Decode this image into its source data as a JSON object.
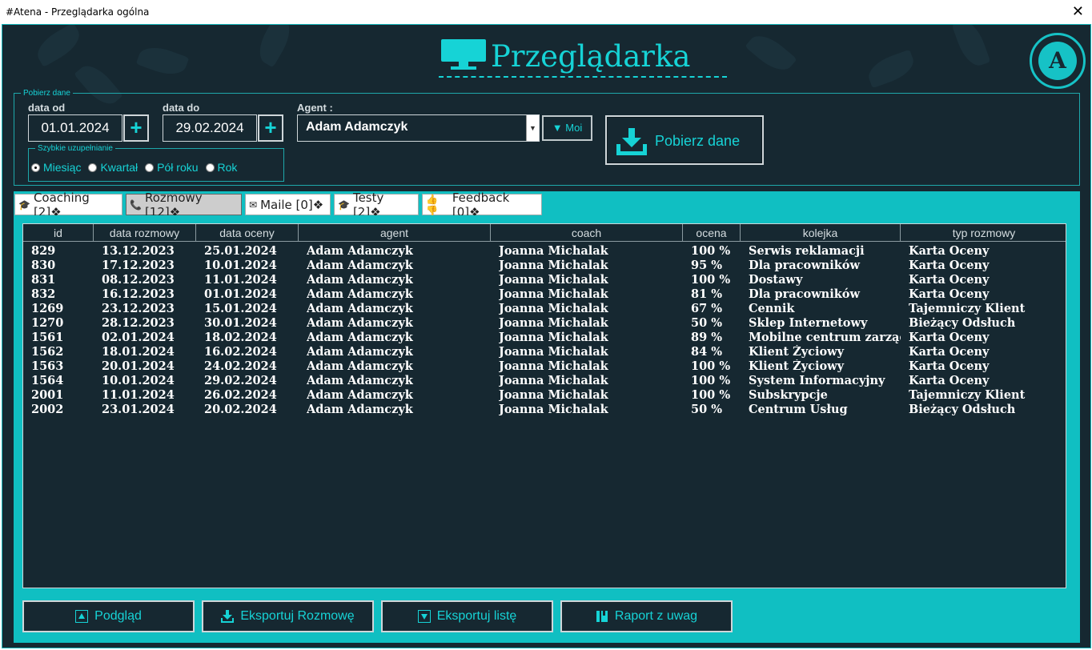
{
  "window": {
    "title": "#Atena - Przeglądarka ogólna",
    "close": "✕"
  },
  "header": {
    "title": "Przeglądarka",
    "logo_letter": "A"
  },
  "pobierz": {
    "legend": "Pobierz dane",
    "date_from_label": "data od",
    "date_from": "01.01.2024",
    "date_to_label": "data do",
    "date_to": "29.02.2024",
    "plus": "+",
    "agent_label": "Agent :",
    "agent_value": "Adam Adamczyk",
    "moi_label": "▼ Moi",
    "button_label": "Pobierz dane",
    "quick": {
      "legend": "Szybkie uzupełnianie",
      "options": [
        "Miesiąc",
        "Kwartał",
        "Pół roku",
        "Rok"
      ],
      "selected": "Miesiąc"
    }
  },
  "tabs": [
    {
      "label": "Coaching [2]❖",
      "icon": "graduation-cap-icon"
    },
    {
      "label": "Rozmowy [12]❖",
      "icon": "phone-icon",
      "active": true
    },
    {
      "label": "Maile [0]❖",
      "icon": "mail-icon"
    },
    {
      "label": "Testy [2]❖",
      "icon": "graduation-cap-icon"
    },
    {
      "label": "Feedback [0]❖",
      "icon": "thumbs-icon"
    }
  ],
  "table": {
    "columns": [
      "id",
      "data rozmowy",
      "data oceny",
      "agent",
      "coach",
      "ocena",
      "kolejka",
      "typ rozmowy"
    ],
    "rows": [
      [
        "829",
        "13.12.2023",
        "25.01.2024",
        "Adam Adamczyk",
        "Joanna Michalak",
        "100 %",
        "Serwis reklamacji",
        "Karta Oceny"
      ],
      [
        "830",
        "17.12.2023",
        "10.01.2024",
        "Adam Adamczyk",
        "Joanna Michalak",
        "95 %",
        "Dla pracowników",
        "Karta Oceny"
      ],
      [
        "831",
        "08.12.2023",
        "11.01.2024",
        "Adam Adamczyk",
        "Joanna Michalak",
        "100 %",
        "Dostawy",
        "Karta Oceny"
      ],
      [
        "832",
        "16.12.2023",
        "01.01.2024",
        "Adam Adamczyk",
        "Joanna Michalak",
        "81 %",
        "Dla pracowników",
        "Karta Oceny"
      ],
      [
        "1269",
        "23.12.2023",
        "15.01.2024",
        "Adam Adamczyk",
        "Joanna Michalak",
        "67 %",
        "Cennik",
        "Tajemniczy Klient"
      ],
      [
        "1270",
        "28.12.2023",
        "30.01.2024",
        "Adam Adamczyk",
        "Joanna Michalak",
        "50 %",
        "Sklep Internetowy",
        "Bieżący Odsłuch"
      ],
      [
        "1561",
        "02.01.2024",
        "18.02.2024",
        "Adam Adamczyk",
        "Joanna Michalak",
        "89 %",
        "Mobilne centrum zarządzania",
        "Karta Oceny"
      ],
      [
        "1562",
        "18.01.2024",
        "16.02.2024",
        "Adam Adamczyk",
        "Joanna Michalak",
        "84 %",
        "Klient Życiowy",
        "Karta Oceny"
      ],
      [
        "1563",
        "20.01.2024",
        "24.02.2024",
        "Adam Adamczyk",
        "Joanna Michalak",
        "100 %",
        "Klient Życiowy",
        "Karta Oceny"
      ],
      [
        "1564",
        "10.01.2024",
        "29.02.2024",
        "Adam Adamczyk",
        "Joanna Michalak",
        "100 %",
        "System Informacyjny",
        "Karta Oceny"
      ],
      [
        "2001",
        "11.01.2024",
        "26.02.2024",
        "Adam Adamczyk",
        "Joanna Michalak",
        "100 %",
        "Subskrypcje",
        "Tajemniczy Klient"
      ],
      [
        "2002",
        "23.01.2024",
        "20.02.2024",
        "Adam Adamczyk",
        "Joanna Michalak",
        "50 %",
        "Centrum Usług",
        "Bieżący Odsłuch"
      ]
    ]
  },
  "buttons": {
    "podglad": "Podgląd",
    "eksportuj_rozmowe": "Eksportuj Rozmowę",
    "eksportuj_liste": "Eksportuj listę",
    "raport": "Raport z uwag"
  },
  "colors": {
    "accent": "#16d3d6",
    "background": "#162831",
    "tab_strip": "#10bfc2"
  }
}
